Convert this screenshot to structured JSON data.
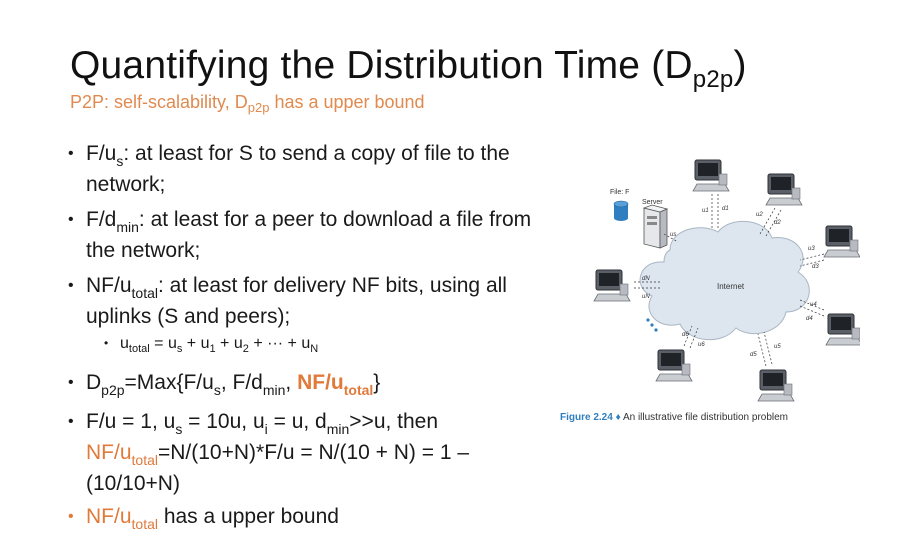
{
  "title": {
    "main": "Quantifying the Distribution Time (D",
    "sub": "p2p",
    "close": ")"
  },
  "subtitle": {
    "a": "P2P: self-scalability, D",
    "sub": "p2p",
    "b": " has a upper  bound"
  },
  "bullets": {
    "b1": {
      "a": "F/u",
      "sub": "s",
      "b": ": at least for S to send a copy of file to the network;"
    },
    "b2": {
      "a": "F/d",
      "sub": "min",
      "b": ": at least for a peer to download a file from the network;"
    },
    "b3": {
      "a": "NF/u",
      "sub": "total",
      "b": ": at least for delivery NF bits, using all uplinks (S and peers);"
    },
    "b3s": {
      "a": "u",
      "s1": "total",
      "b": " = u",
      "s2": "s",
      "c": " + u",
      "s3": "1",
      "d": " + u",
      "s4": "2",
      "e": " + ··· + u",
      "s5": "N"
    },
    "b4": {
      "a": "D",
      "s1": "p2p",
      "b": "=Max{F/u",
      "s2": "s",
      "c": ", F/d",
      "s3": "min",
      "d": ", ",
      "e": "NF/u",
      "s4": "total",
      "f": "}"
    },
    "b5": {
      "a": "F/u = 1, u",
      "s1": "s",
      "b": " = 10u, u",
      "s2": "i",
      "c": " = u, d",
      "s3": "min",
      "d": ">>u, then ",
      "e": "NF/u",
      "s4": "total",
      "f": "=N/(10+N)*F/u = N/(10 + N) = 1 – (10/10+N)"
    },
    "b6": {
      "a": "NF/u",
      "sub": "total",
      "b": " has a upper bound"
    }
  },
  "figure": {
    "file_label": "File: F",
    "server_label": "Server",
    "internet_label": "Internet",
    "caption_fig": "Figure 2.24",
    "caption_sep": "♦",
    "caption_text": "An illustrative file distribution problem",
    "labels": {
      "u1": "u1",
      "d1": "d1",
      "u2": "u2",
      "d2": "d2",
      "u3": "u3",
      "d3": "d3",
      "u4": "u4",
      "d4": "d4",
      "u5": "u5",
      "d5": "d5",
      "u6": "u6",
      "d6": "d6",
      "uN": "uN",
      "dN": "dN",
      "us": "us"
    }
  },
  "colors": {
    "accent": "#e07a3a",
    "figure_blue": "#2f7fc0",
    "cloud": "#dde6ef"
  },
  "icons": [
    "server-icon",
    "file-cylinder-icon",
    "peer-computer-icon",
    "cloud-icon"
  ]
}
